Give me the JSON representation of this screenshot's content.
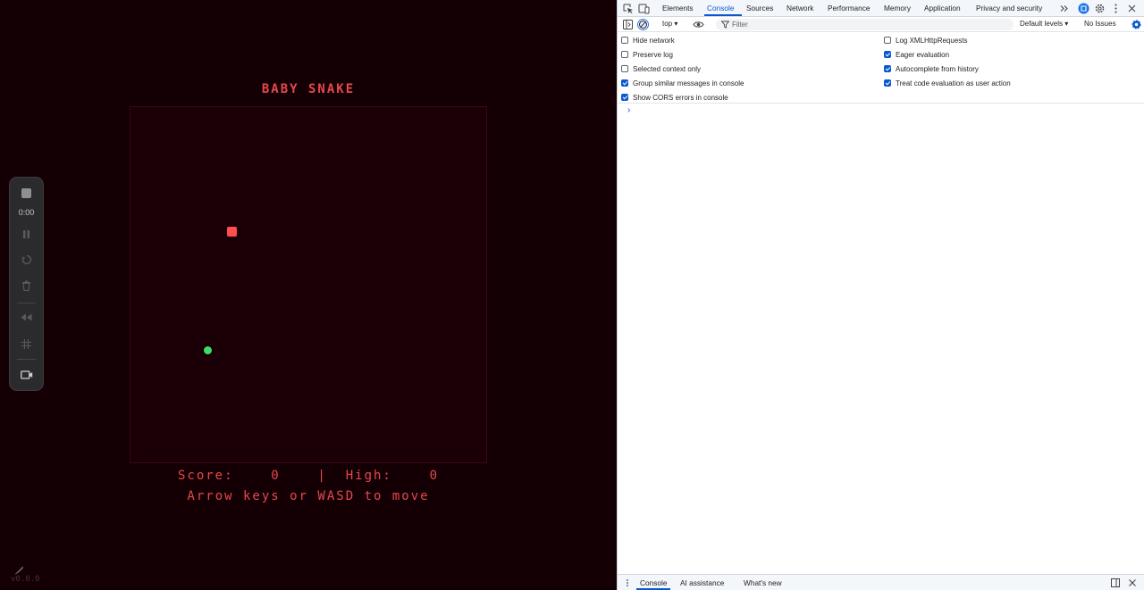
{
  "game": {
    "title": "BABY SNAKE",
    "score_label": "Score:",
    "score": "0",
    "separator": "|",
    "high_label": "High:",
    "high": "0",
    "hint": "Arrow keys or WASD to move",
    "version": "v0.0.0",
    "colors": {
      "background": "#140004",
      "text": "#e5484d",
      "food": "#ff4d4d",
      "snake": "#3ddc67"
    }
  },
  "recorder": {
    "time": "0:00",
    "icons": [
      "stop-icon",
      "pause-icon",
      "restart-icon",
      "trash-icon",
      "rewind-icon",
      "grid-icon",
      "camera-icon"
    ]
  },
  "devtools": {
    "tabs": [
      "Elements",
      "Console",
      "Sources",
      "Network",
      "Performance",
      "Memory",
      "Application",
      "Privacy and security"
    ],
    "active_tab": "Console",
    "context": "top",
    "filter_placeholder": "Filter",
    "levels": "Default levels",
    "issues": "No Issues",
    "settings_left": [
      {
        "label": "Hide network",
        "checked": false
      },
      {
        "label": "Preserve log",
        "checked": false
      },
      {
        "label": "Selected context only",
        "checked": false
      },
      {
        "label": "Group similar messages in console",
        "checked": true
      },
      {
        "label": "Show CORS errors in console",
        "checked": true
      }
    ],
    "settings_right": [
      {
        "label": "Log XMLHttpRequests",
        "checked": false
      },
      {
        "label": "Eager evaluation",
        "checked": true
      },
      {
        "label": "Autocomplete from history",
        "checked": true
      },
      {
        "label": "Treat code evaluation as user action",
        "checked": true
      }
    ],
    "prompt": "›",
    "drawer_tabs": [
      "Console",
      "AI assistance",
      "What's new"
    ],
    "accent": "#0b57d0"
  }
}
